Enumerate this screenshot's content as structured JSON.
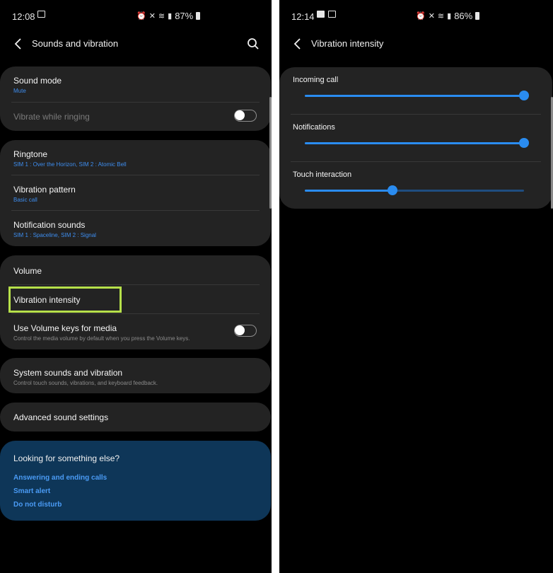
{
  "left": {
    "status": {
      "time": "12:08",
      "battery": "87%"
    },
    "title": "Sounds and vibration",
    "sound_mode": {
      "title": "Sound mode",
      "value": "Mute"
    },
    "vibrate_while_ringing": {
      "title": "Vibrate while ringing",
      "enabled": false
    },
    "ringtone": {
      "title": "Ringtone",
      "value": "SIM 1 : Over the Horizon, SIM 2 : Atomic Bell"
    },
    "vibration_pattern": {
      "title": "Vibration pattern",
      "value": "Basic call"
    },
    "notification_sounds": {
      "title": "Notification sounds",
      "value": "SIM 1 : Spaceline, SIM 2 : Signal"
    },
    "volume": {
      "title": "Volume"
    },
    "vibration_intensity": {
      "title": "Vibration intensity"
    },
    "volume_keys": {
      "title": "Use Volume keys for media",
      "description": "Control the media volume by default when you press the Volume keys.",
      "enabled": false
    },
    "system_sounds": {
      "title": "System sounds and vibration",
      "description": "Control touch sounds, vibrations, and keyboard feedback."
    },
    "advanced": {
      "title": "Advanced sound settings"
    },
    "suggestions": {
      "question": "Looking for something else?",
      "links": [
        "Answering and ending calls",
        "Smart alert",
        "Do not disturb"
      ]
    }
  },
  "right": {
    "status": {
      "time": "12:14",
      "battery": "86%"
    },
    "title": "Vibration intensity",
    "sliders": [
      {
        "label": "Incoming call",
        "level": 1.0
      },
      {
        "label": "Notifications",
        "level": 1.0
      },
      {
        "label": "Touch interaction",
        "level": 0.4
      }
    ]
  },
  "icons": [
    "back-arrow-icon",
    "search-icon",
    "alarm-icon",
    "mute-icon",
    "wifi-icon",
    "signal-icon",
    "battery-icon",
    "laptop-icon",
    "image-icon"
  ],
  "colors": {
    "accent": "#2a8cf0",
    "link": "#4a9bf5",
    "highlight": "#b6e04a",
    "card": "#232323",
    "suggest_card": "#0e3658"
  }
}
